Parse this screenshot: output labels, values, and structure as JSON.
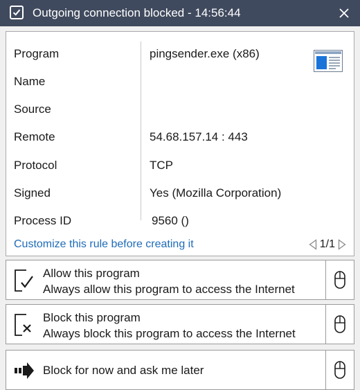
{
  "window": {
    "title": "Outgoing connection blocked - 14:56:44"
  },
  "details": {
    "rows": [
      {
        "label": "Program",
        "value": "pingsender.exe (x86)"
      },
      {
        "label": "Name",
        "value": ""
      },
      {
        "label": "Source",
        "value": ""
      },
      {
        "label": "Remote",
        "value": "54.68.157.14 : 443"
      },
      {
        "label": "Protocol",
        "value": "TCP"
      },
      {
        "label": "Signed",
        "value": "Yes (Mozilla Corporation)"
      },
      {
        "label": "Process ID",
        "value": "9560 ()"
      }
    ],
    "program_icon": "application-window-icon"
  },
  "customize_link": "Customize this rule before creating it",
  "pager": {
    "text": "1/1"
  },
  "actions": {
    "allow": {
      "title": "Allow this program",
      "desc": "Always allow this program to access the Internet",
      "icon": "allow-check-icon"
    },
    "block": {
      "title": "Block this program",
      "desc": "Always block this program to access the Internet",
      "icon": "block-x-icon"
    },
    "later": {
      "title": "Block for now and ask me later",
      "icon": "arrow-right-icon"
    }
  },
  "colors": {
    "titlebar": "#404a5e",
    "link": "#1e6bb8",
    "accent_blue": "#1a73d9"
  }
}
